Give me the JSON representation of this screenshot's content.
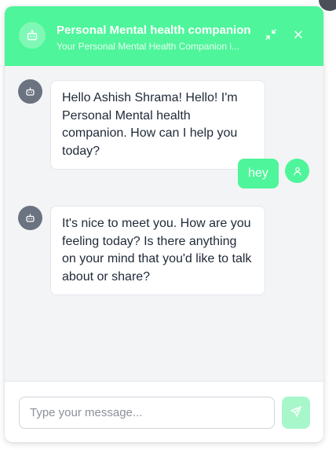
{
  "header": {
    "title": "Personal Mental health companion",
    "subtitle": "Your Personal Mental Health Companion i...",
    "icons": {
      "avatar": "robot-icon",
      "minimize": "minimize-icon",
      "close": "close-icon"
    }
  },
  "messages": [
    {
      "sender": "bot",
      "avatar_icon": "robot-icon",
      "text": "Hello Ashish Shrama! Hello! I'm Personal Mental health companion. How can I help you today?"
    },
    {
      "sender": "user",
      "avatar_icon": "user-icon",
      "text": "hey"
    },
    {
      "sender": "bot",
      "avatar_icon": "robot-icon",
      "text": "It's nice to meet you. How are you feeling today? Is there anything on your mind that you'd like to talk about or share?"
    }
  ],
  "composer": {
    "placeholder": "Type your message...",
    "value": "",
    "send_icon": "send-icon"
  },
  "colors": {
    "accent": "#4ef59a",
    "accent_muted": "#a7f7cb",
    "bot_avatar": "#6b7280",
    "background": "#f3f4f6"
  }
}
